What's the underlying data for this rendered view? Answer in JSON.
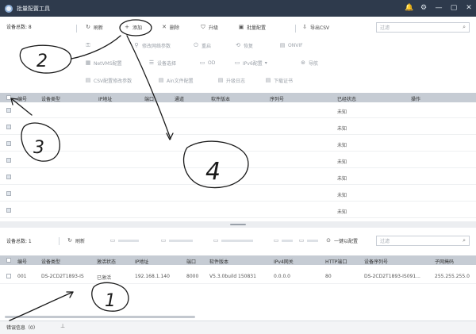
{
  "window": {
    "title": "批量配置工具",
    "controls": [
      "🔔",
      "⚙",
      "—",
      "▢",
      "✕"
    ]
  },
  "toolbar": {
    "device_count": "设备总数: 8",
    "row1": [
      {
        "label": "刷新",
        "icon": "↻",
        "name": "refresh-button"
      },
      {
        "label": "添加",
        "icon": "+",
        "name": "add-button"
      },
      {
        "label": "删除",
        "icon": "✕",
        "name": "delete-button"
      },
      {
        "label": "升级",
        "icon": "⛉",
        "name": "upgrade-button"
      },
      {
        "label": "批量配置",
        "icon": "▣",
        "name": "batch-config-button"
      },
      {
        "label": "导出CSV",
        "icon": "⇩",
        "name": "export-csv-button"
      }
    ],
    "search_placeholder": "过滤",
    "row2": [
      {
        "label": "",
        "icon": "⚿",
        "name": "row2-tool-1"
      },
      {
        "label": "修改网络参数",
        "icon": "⚲",
        "name": "modify-network-button"
      },
      {
        "label": "重启",
        "icon": "⏻",
        "name": "reboot-button"
      },
      {
        "label": "恢复",
        "icon": "⟲",
        "name": "restore-button"
      },
      {
        "label": "ONVIF",
        "icon": "▤",
        "name": "onvif-button"
      }
    ],
    "row3": [
      {
        "label": "NetVMS配置",
        "icon": "▦",
        "name": "netvms-config-button"
      },
      {
        "label": "设备选择",
        "icon": "☰",
        "name": "device-select-button"
      },
      {
        "label": "OD",
        "icon": "▭",
        "name": "od-button"
      },
      {
        "label": "IPv6配置",
        "icon": "▭",
        "name": "ipv6-config-button"
      },
      {
        "label": "导航",
        "icon": "⊛",
        "name": "navigate-button"
      }
    ],
    "row4": [
      {
        "label": "CSV配置修改参数",
        "icon": "▤",
        "name": "csv-config-button"
      },
      {
        "label": "Ain文件配置",
        "icon": "▤",
        "name": "ain-file-config-button"
      },
      {
        "label": "升级日志",
        "icon": "▤",
        "name": "upgrade-log-button"
      },
      {
        "label": "下载证书",
        "icon": "▤",
        "name": "download-cert-button"
      }
    ]
  },
  "top_table": {
    "headers": [
      "编号",
      "设备类型",
      "IP地址",
      "端口",
      "通道",
      "软件版本",
      "序列号",
      "已经状态",
      "操作"
    ],
    "rows": [
      {
        "status": "未知"
      },
      {
        "status": "未知"
      },
      {
        "status": "未知"
      },
      {
        "status": "未知"
      },
      {
        "status": "未知"
      },
      {
        "status": "未知"
      },
      {
        "status": "未知"
      }
    ]
  },
  "bottom_toolbar": {
    "device_count": "设备总数: 1",
    "buttons": [
      {
        "label": "刷新",
        "icon": "↻",
        "name": "bottom-refresh-button"
      },
      {
        "label": "",
        "icon": "",
        "name": "bottom-tool-2"
      },
      {
        "label": "",
        "icon": "",
        "name": "bottom-tool-3"
      },
      {
        "label": "",
        "icon": "",
        "name": "bottom-tool-4"
      },
      {
        "label": "",
        "icon": "",
        "name": "bottom-tool-5"
      },
      {
        "label": "",
        "icon": "",
        "name": "bottom-tool-6"
      }
    ],
    "one_click_config": "一键以配置",
    "search_placeholder": "过滤"
  },
  "bottom_table": {
    "headers": [
      "编号",
      "设备类型",
      "激活状态",
      "IP地址",
      "端口",
      "软件版本",
      "IPv4网关",
      "HTTP端口",
      "设备序列号",
      "子网掩码"
    ],
    "rows": [
      {
        "no": "001",
        "type": "DS-2CD2T1893-IS",
        "active": "已激活",
        "ip": "192.168.1.140",
        "port": "8000",
        "version": "V5.3.0build 150831",
        "gateway": "0.0.0.0",
        "http": "80",
        "serial": "DS-2CD2T1893-IS091...",
        "mask": "255.255.255.0"
      }
    ]
  },
  "statusbar": {
    "tab": "错误信息（0）",
    "pin": "⊥"
  },
  "annotations": {
    "labels": [
      "2",
      "3",
      "4",
      "1"
    ]
  }
}
